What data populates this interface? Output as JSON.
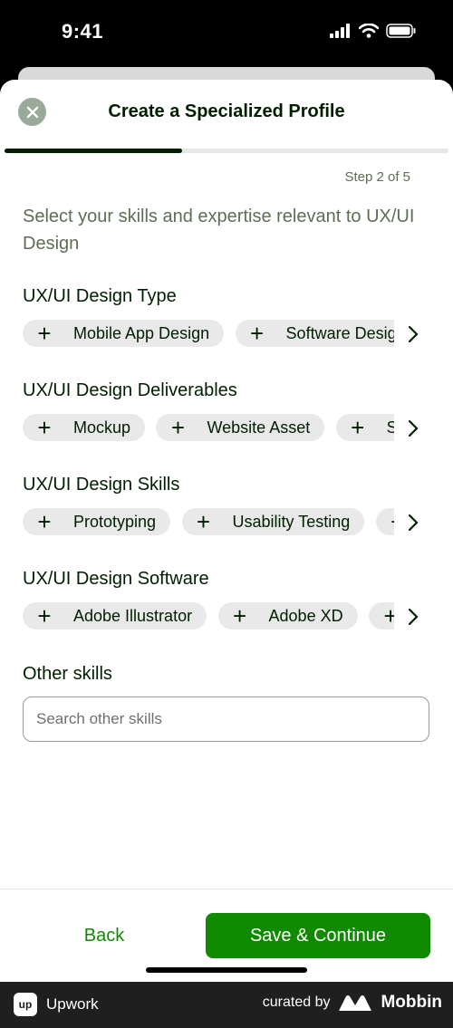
{
  "status": {
    "time": "9:41"
  },
  "header": {
    "title": "Create a Specialized Profile",
    "progress": 0.4
  },
  "step": "Step 2 of 5",
  "intro": "Select your skills and expertise relevant to UX/UI Design",
  "sections": [
    {
      "title": "UX/UI Design Type",
      "chips": [
        "Mobile App Design",
        "Software Design"
      ]
    },
    {
      "title": "UX/UI Design Deliverables",
      "chips": [
        "Mockup",
        "Website Asset",
        "S"
      ]
    },
    {
      "title": "UX/UI Design Skills",
      "chips": [
        "Prototyping",
        "Usability Testing",
        ""
      ]
    },
    {
      "title": "UX/UI Design Software",
      "chips": [
        "Adobe Illustrator",
        "Adobe XD",
        ""
      ]
    }
  ],
  "other": {
    "title": "Other skills",
    "placeholder": "Search other skills"
  },
  "footer": {
    "back": "Back",
    "continue": "Save & Continue"
  },
  "brand": {
    "app": "Upwork",
    "app_logo": "up",
    "curated": "curated by",
    "mobbin": "Mobbin"
  },
  "colors": {
    "brand_green": "#108a00",
    "text_dark": "#001e00",
    "muted": "#5e6d55"
  }
}
